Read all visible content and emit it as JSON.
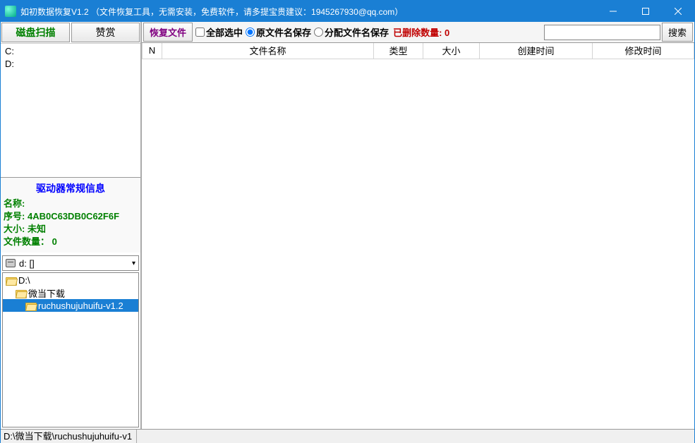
{
  "window": {
    "title": "如初数据恢复V1.2 （文件恢复工具，无需安装，免费软件，请多提宝贵建议：1945267930@qq.com）"
  },
  "left": {
    "scan_btn": "磁盘扫描",
    "donate_btn": "赞赏",
    "drives": [
      "C:",
      "D:"
    ],
    "info": {
      "header": "驱动器常规信息",
      "name_label": "名称:",
      "name_value": "",
      "serial_label": "序号:",
      "serial_value": "4AB0C63DB0C62F6F",
      "size_label": "大小:",
      "size_value": "未知",
      "files_label": "文件数量：",
      "files_value": "0"
    },
    "combo": "d: []",
    "tree": [
      {
        "label": "D:\\",
        "indent": 0,
        "open": true,
        "sel": false
      },
      {
        "label": "微当下载",
        "indent": 1,
        "open": true,
        "sel": false
      },
      {
        "label": "ruchushujuhuifu-v1.2",
        "indent": 2,
        "open": true,
        "sel": true
      }
    ]
  },
  "toolbar": {
    "recover": "恢复文件",
    "select_all": "全部选中",
    "keep_name": "原文件名保存",
    "assign_name": "分配文件名保存",
    "deleted_label": "已删除数量:",
    "deleted_count": "0",
    "search_btn": "搜索"
  },
  "grid": {
    "cols": [
      "N",
      "文件名称",
      "类型",
      "大小",
      "创建时间",
      "修改时间"
    ]
  },
  "status": {
    "path": "D:\\微当下载\\ruchushujuhuifu-v1"
  }
}
